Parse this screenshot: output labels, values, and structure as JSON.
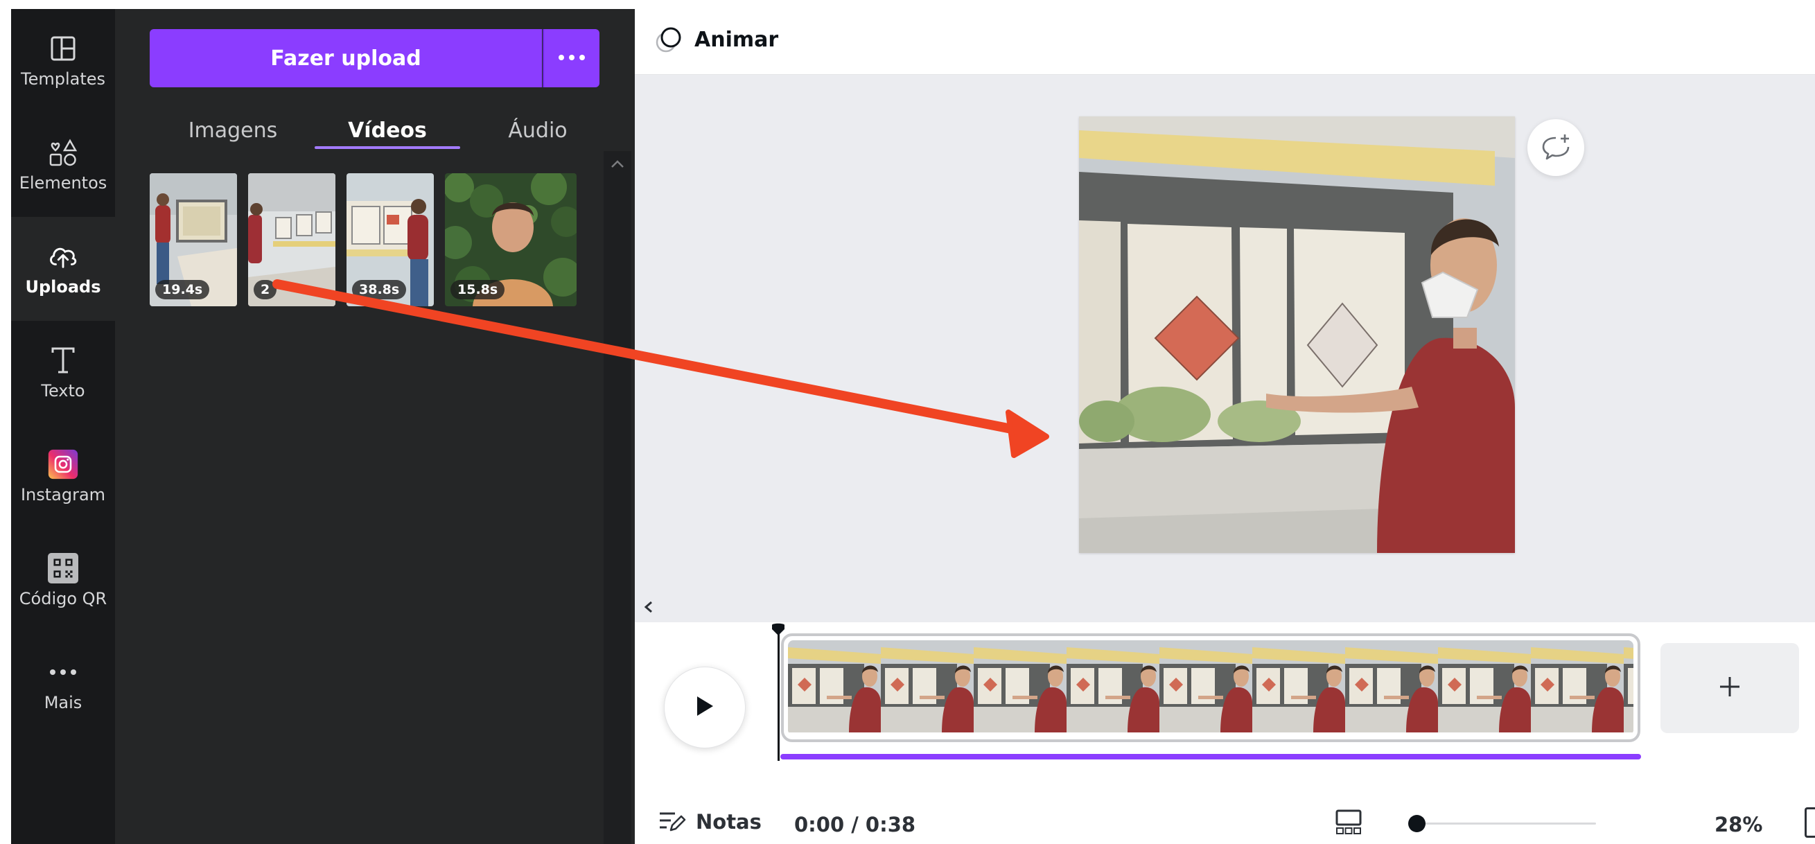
{
  "rail": {
    "items": [
      {
        "label": "Templates",
        "icon": "templates-icon"
      },
      {
        "label": "Elementos",
        "icon": "elements-icon"
      },
      {
        "label": "Uploads",
        "icon": "upload-cloud-icon",
        "active": true
      },
      {
        "label": "Texto",
        "icon": "text-icon"
      },
      {
        "label": "Instagram",
        "icon": "instagram-icon"
      },
      {
        "label": "Código QR",
        "icon": "qr-code-icon"
      },
      {
        "label": "Mais",
        "icon": "more-dots-icon"
      }
    ]
  },
  "panel": {
    "upload_label": "Fazer upload",
    "tabs": [
      {
        "label": "Imagens"
      },
      {
        "label": "Vídeos",
        "active": true
      },
      {
        "label": "Áudio"
      }
    ],
    "videos": [
      {
        "duration": "19.4s"
      },
      {
        "duration": "2"
      },
      {
        "duration": "38.8s"
      },
      {
        "duration": "15.8s"
      }
    ]
  },
  "toolbar": {
    "animate_label": "Animar"
  },
  "footer": {
    "notes_label": "Notas",
    "timecode": "0:00 / 0:38",
    "zoom": "28%",
    "zoom_level": 0.28
  },
  "colors": {
    "accent": "#8b3dff",
    "sidebar_bg": "#18191b",
    "panel_bg": "#252627",
    "canvas_bg": "#ebecf0",
    "arrow": "#f04423"
  }
}
